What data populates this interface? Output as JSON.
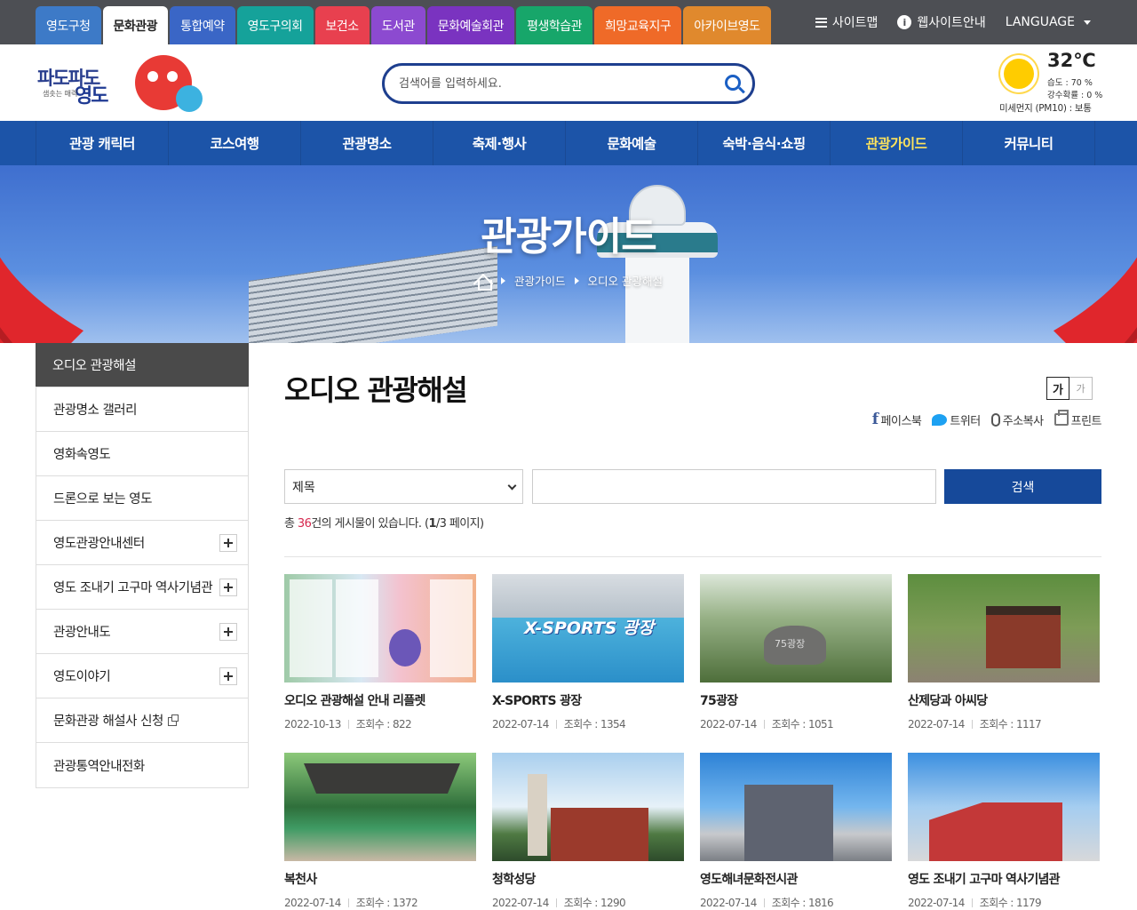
{
  "topbar": {
    "tabs": [
      {
        "label": "영도구청",
        "color": "#3d7ac7"
      },
      {
        "label": "문화관광",
        "color": "#ffffff"
      },
      {
        "label": "통합예약",
        "color": "#3a66c6"
      },
      {
        "label": "영도구의회",
        "color": "#15a29a"
      },
      {
        "label": "보건소",
        "color": "#e8404f"
      },
      {
        "label": "도서관",
        "color": "#8c4ad0"
      },
      {
        "label": "문화예술회관",
        "color": "#7a33c0"
      },
      {
        "label": "평생학습관",
        "color": "#17a66a"
      },
      {
        "label": "희망교육지구",
        "color": "#ef6a28"
      },
      {
        "label": "아카이브영도",
        "color": "#e0892d"
      }
    ],
    "sitemap": "사이트맵",
    "guide": "웹사이트안내",
    "language": "LANGUAGE"
  },
  "header": {
    "logo_text": "파도파도",
    "logo_text2": "영도",
    "logo_slogan": "샘솟는 매력",
    "search_placeholder": "검색어를 입력하세요.",
    "weather": {
      "temp": "32℃",
      "humidity": "습도 : 70 %",
      "rain": "강수확률 : 0 %",
      "dust": "미세먼지 (PM10) : 보통"
    }
  },
  "gnb": [
    "관광 캐릭터",
    "코스여행",
    "관광명소",
    "축제·행사",
    "문화예술",
    "숙박·음식·쇼핑",
    "관광가이드",
    "커뮤니티"
  ],
  "hero": {
    "title": "관광가이드",
    "crumb": [
      "관광가이드",
      "오디오 관광해설"
    ]
  },
  "lnb": [
    {
      "label": "오디오 관광해설",
      "active": true
    },
    {
      "label": "관광명소 갤러리"
    },
    {
      "label": "영화속영도"
    },
    {
      "label": "드론으로 보는 영도"
    },
    {
      "label": "영도관광안내센터",
      "plus": true
    },
    {
      "label": "영도 조내기 고구마 역사기념관",
      "plus": true
    },
    {
      "label": "관광안내도",
      "plus": true
    },
    {
      "label": "영도이야기",
      "plus": true
    },
    {
      "label": "문화관광 해설사 신청",
      "newwin": true
    },
    {
      "label": "관광통역안내전화"
    }
  ],
  "content": {
    "title": "오디오 관광해설",
    "font_large": "가",
    "font_small": "가",
    "share": {
      "facebook": "페이스북",
      "twitter": "트위터",
      "copy": "주소복사",
      "print": "프린트"
    },
    "search": {
      "select": "제목",
      "button": "검색"
    },
    "total": {
      "prefix": "총 ",
      "count": "36",
      "mid": "건의 게시물이 있습니다. (",
      "page": "1",
      "suffix": "/3 페이지)"
    },
    "views_label": "조회수 : ",
    "items": [
      {
        "title": "오디오 관광해설 안내 리플렛",
        "date": "2022-10-13",
        "views": "822"
      },
      {
        "title": "X-SPORTS 광장",
        "date": "2022-07-14",
        "views": "1354",
        "badge": "X-SPORTS 광장"
      },
      {
        "title": "75광장",
        "date": "2022-07-14",
        "views": "1051",
        "badge": "75광장"
      },
      {
        "title": "산제당과 아씨당",
        "date": "2022-07-14",
        "views": "1117"
      },
      {
        "title": "복천사",
        "date": "2022-07-14",
        "views": "1372"
      },
      {
        "title": "청학성당",
        "date": "2022-07-14",
        "views": "1290"
      },
      {
        "title": "영도해녀문화전시관",
        "date": "2022-07-14",
        "views": "1816"
      },
      {
        "title": "영도 조내기 고구마 역사기념관",
        "date": "2022-07-14",
        "views": "1179"
      }
    ]
  }
}
